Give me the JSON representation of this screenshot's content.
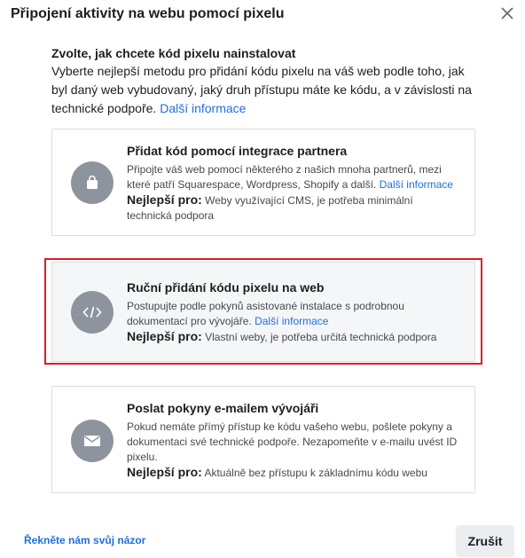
{
  "dialog": {
    "title": "Připojení aktivity na webu pomocí pixelu"
  },
  "intro": {
    "heading": "Zvolte, jak chcete kód pixelu nainstalovat",
    "description": "Vyberte nejlepší metodu pro přidání kódu pixelu na váš web podle toho, jak byl daný web vybudovaný, jaký druh přístupu máte ke kódu, a v závislosti na technické podpoře.",
    "link": "Další informace"
  },
  "options": [
    {
      "title": "Přidat kód pomocí integrace partnera",
      "description": "Připojte váš web pomocí některého z našich mnoha partnerů, mezi které patří Squarespace, Wordpress, Shopify a další.",
      "link": "Další informace",
      "best_for_label": "Nejlepší pro:",
      "best_for_value": "Weby využívající CMS, je potřeba minimální technická podpora",
      "icon": "shopping-bag-icon"
    },
    {
      "title": "Ruční přidání kódu pixelu na web",
      "description": "Postupujte podle pokynů asistované instalace s podrobnou dokumentací pro vývojáře.",
      "link": "Další informace",
      "best_for_label": "Nejlepší pro:",
      "best_for_value": "Vlastní weby, je potřeba určitá technická podpora",
      "icon": "code-icon",
      "selected": true
    },
    {
      "title": "Poslat pokyny e-mailem vývojáři",
      "description": "Pokud nemáte přímý přístup ke kódu vašeho webu, pošlete pokyny a dokumentaci své technické podpoře. Nezapomeňte v e-mailu uvést ID pixelu.",
      "best_for_label": "Nejlepší pro:",
      "best_for_value": "Aktuálně bez přístupu k základnímu kódu webu",
      "icon": "envelope-icon"
    }
  ],
  "footer": {
    "feedback": "Řekněte nám svůj názor",
    "cancel": "Zrušit"
  },
  "colors": {
    "link": "#216fdb",
    "highlight": "#e11b22",
    "icon_circle": "#8d949e"
  }
}
